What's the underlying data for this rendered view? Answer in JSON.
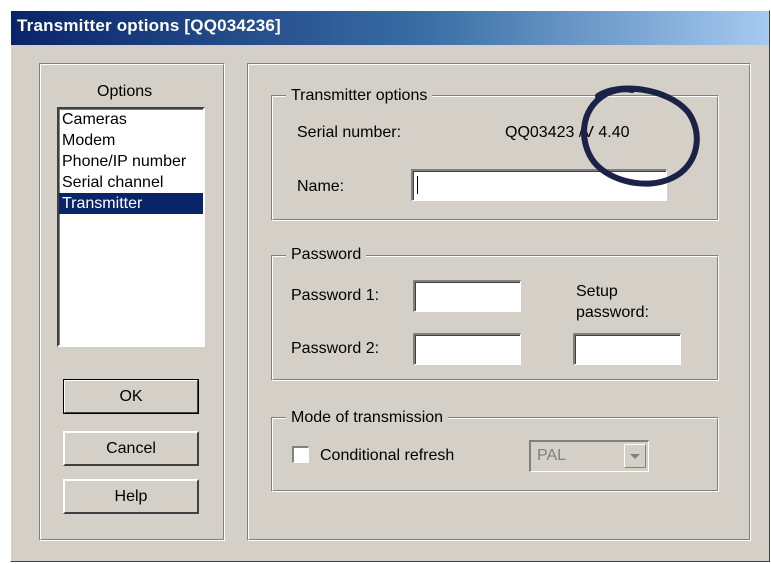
{
  "window": {
    "title": "Transmitter options [QQ034236]"
  },
  "options_panel": {
    "title": "Options",
    "items": [
      {
        "label": "Cameras",
        "selected": false
      },
      {
        "label": "Modem",
        "selected": false
      },
      {
        "label": "Phone/IP number",
        "selected": false
      },
      {
        "label": "Serial channel",
        "selected": false
      },
      {
        "label": "Transmitter",
        "selected": true
      }
    ]
  },
  "buttons": {
    "ok": "OK",
    "cancel": "Cancel",
    "help": "Help"
  },
  "transmitter_group": {
    "legend": "Transmitter options",
    "serial_label": "Serial number:",
    "serial_value": "QQ03423 /V  4.40",
    "name_label": "Name:",
    "name_value": ""
  },
  "password_group": {
    "legend": "Password",
    "password1_label": "Password 1:",
    "password2_label": "Password 2:",
    "setup_label_line1": "Setup",
    "setup_label_line2": "password:",
    "password1_value": "",
    "password2_value": "",
    "setup_value": ""
  },
  "mode_group": {
    "legend": "Mode of transmission",
    "checkbox_label": "Conditional refresh",
    "checkbox_checked": false,
    "video_format": "PAL"
  },
  "annotation": {
    "color": "#1a2347",
    "shape": "hand-drawn-ellipse"
  }
}
